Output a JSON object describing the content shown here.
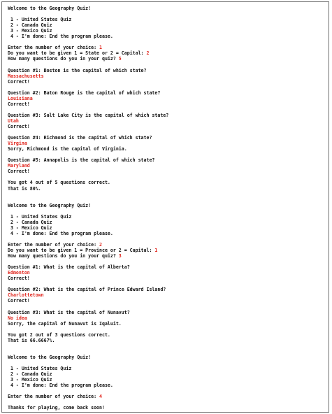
{
  "colors": {
    "output_text": "#111111",
    "user_input": "#e0231a",
    "background": "#ffffff",
    "border": "#6f6f6f"
  },
  "lines": [
    {
      "parts": [
        {
          "t": "Welcome to the Geography Quiz!"
        }
      ]
    },
    {
      "parts": []
    },
    {
      "parts": [
        {
          "t": " 1 - United States Quiz"
        }
      ]
    },
    {
      "parts": [
        {
          "t": " 2 - Canada Quiz"
        }
      ]
    },
    {
      "parts": [
        {
          "t": " 3 - Mexico Quiz"
        }
      ]
    },
    {
      "parts": [
        {
          "t": " 4 - I'm done: End the program please."
        }
      ]
    },
    {
      "parts": []
    },
    {
      "parts": [
        {
          "t": "Enter the number of your choice: "
        },
        {
          "t": "1",
          "input": true
        }
      ]
    },
    {
      "parts": [
        {
          "t": "Do you want to be given 1 = State or 2 = Capital: "
        },
        {
          "t": "2",
          "input": true
        }
      ]
    },
    {
      "parts": [
        {
          "t": "How many questions do you in your quiz? "
        },
        {
          "t": "5",
          "input": true
        }
      ]
    },
    {
      "parts": []
    },
    {
      "parts": [
        {
          "t": "Question #1: Boston is the capital of which state?"
        }
      ]
    },
    {
      "parts": [
        {
          "t": "Massachusetts",
          "input": true
        }
      ]
    },
    {
      "parts": [
        {
          "t": "Correct!"
        }
      ]
    },
    {
      "parts": []
    },
    {
      "parts": [
        {
          "t": "Question #2: Baton Rouge is the capital of which state?"
        }
      ]
    },
    {
      "parts": [
        {
          "t": "Louisiana",
          "input": true
        }
      ]
    },
    {
      "parts": [
        {
          "t": "Correct!"
        }
      ]
    },
    {
      "parts": []
    },
    {
      "parts": [
        {
          "t": "Question #3: Salt Lake City is the capital of which state?"
        }
      ]
    },
    {
      "parts": [
        {
          "t": "Utah",
          "input": true
        }
      ]
    },
    {
      "parts": [
        {
          "t": "Correct!"
        }
      ]
    },
    {
      "parts": []
    },
    {
      "parts": [
        {
          "t": "Question #4: Richmond is the capital of which state?"
        }
      ]
    },
    {
      "parts": [
        {
          "t": "Virgina",
          "input": true
        }
      ]
    },
    {
      "parts": [
        {
          "t": "Sorry, Richmond is the capital of Virginia."
        }
      ]
    },
    {
      "parts": []
    },
    {
      "parts": [
        {
          "t": "Question #5: Annapolis is the capital of which state?"
        }
      ]
    },
    {
      "parts": [
        {
          "t": "Maryland",
          "input": true
        }
      ]
    },
    {
      "parts": [
        {
          "t": "Correct!"
        }
      ]
    },
    {
      "parts": []
    },
    {
      "parts": [
        {
          "t": "You got 4 out of 5 questions correct."
        }
      ]
    },
    {
      "parts": [
        {
          "t": "That is 80%."
        }
      ]
    },
    {
      "parts": []
    },
    {
      "parts": []
    },
    {
      "parts": [
        {
          "t": "Welcome to the Geography Quiz!"
        }
      ]
    },
    {
      "parts": []
    },
    {
      "parts": [
        {
          "t": " 1 - United States Quiz"
        }
      ]
    },
    {
      "parts": [
        {
          "t": " 2 - Canada Quiz"
        }
      ]
    },
    {
      "parts": [
        {
          "t": " 3 - Mexico Quiz"
        }
      ]
    },
    {
      "parts": [
        {
          "t": " 4 - I'm done: End the program please."
        }
      ]
    },
    {
      "parts": []
    },
    {
      "parts": [
        {
          "t": "Enter the number of your choice: "
        },
        {
          "t": "2",
          "input": true
        }
      ]
    },
    {
      "parts": [
        {
          "t": "Do you want to be given 1 = Province or 2 = Capital: "
        },
        {
          "t": "1",
          "input": true
        }
      ]
    },
    {
      "parts": [
        {
          "t": "How many questions do you in your quiz? "
        },
        {
          "t": "3",
          "input": true
        }
      ]
    },
    {
      "parts": []
    },
    {
      "parts": [
        {
          "t": "Question #1: What is the capital of Alberta?"
        }
      ]
    },
    {
      "parts": [
        {
          "t": "Edmonton",
          "input": true
        }
      ]
    },
    {
      "parts": [
        {
          "t": "Correct!"
        }
      ]
    },
    {
      "parts": []
    },
    {
      "parts": [
        {
          "t": "Question #2: What is the capital of Prince Edward Island?"
        }
      ]
    },
    {
      "parts": [
        {
          "t": "Charlottetown",
          "input": true
        }
      ]
    },
    {
      "parts": [
        {
          "t": "Correct!"
        }
      ]
    },
    {
      "parts": []
    },
    {
      "parts": [
        {
          "t": "Question #3: What is the capital of Nunavut?"
        }
      ]
    },
    {
      "parts": [
        {
          "t": "No idea",
          "input": true
        }
      ]
    },
    {
      "parts": [
        {
          "t": "Sorry, the capital of Nunavut is Iqaluit."
        }
      ]
    },
    {
      "parts": []
    },
    {
      "parts": [
        {
          "t": "You got 2 out of 3 questions correct."
        }
      ]
    },
    {
      "parts": [
        {
          "t": "That is 66.6667%."
        }
      ]
    },
    {
      "parts": []
    },
    {
      "parts": []
    },
    {
      "parts": [
        {
          "t": "Welcome to the Geography Quiz!"
        }
      ]
    },
    {
      "parts": []
    },
    {
      "parts": [
        {
          "t": " 1 - United States Quiz"
        }
      ]
    },
    {
      "parts": [
        {
          "t": " 2 - Canada Quiz"
        }
      ]
    },
    {
      "parts": [
        {
          "t": " 3 - Mexico Quiz"
        }
      ]
    },
    {
      "parts": [
        {
          "t": " 4 - I'm done: End the program please."
        }
      ]
    },
    {
      "parts": []
    },
    {
      "parts": [
        {
          "t": "Enter the number of your choice: "
        },
        {
          "t": "4",
          "input": true
        }
      ]
    },
    {
      "parts": []
    },
    {
      "parts": [
        {
          "t": "Thanks for playing, come back soon!"
        }
      ]
    }
  ]
}
